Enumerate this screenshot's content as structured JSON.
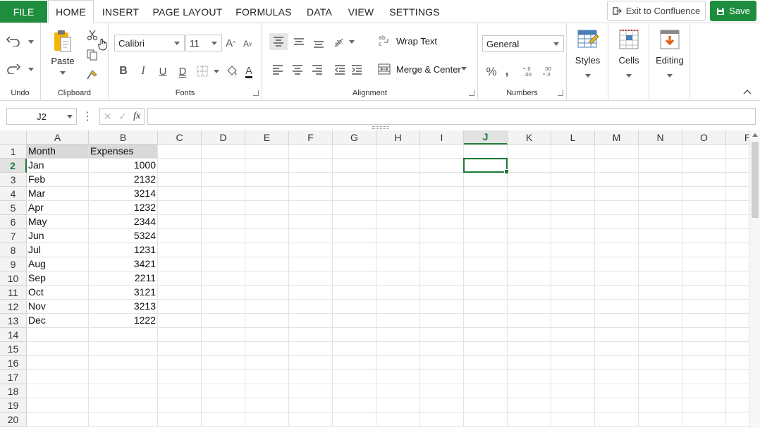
{
  "tabs": {
    "file": "FILE",
    "items": [
      "HOME",
      "INSERT",
      "PAGE LAYOUT",
      "FORMULAS",
      "DATA",
      "VIEW",
      "SETTINGS"
    ],
    "active": "HOME"
  },
  "actions": {
    "exit_label": "Exit to Confluence",
    "save_label": "Save"
  },
  "ribbon": {
    "undo_group": "Undo",
    "clipboard_group": "Clipboard",
    "paste_label": "Paste",
    "fonts_group": "Fonts",
    "font_name": "Calibri",
    "font_size": "11",
    "alignment_group": "Alignment",
    "wrap_text": "Wrap Text",
    "merge_center": "Merge & Center",
    "numbers_group": "Numbers",
    "number_format": "General",
    "styles_label": "Styles",
    "cells_label": "Cells",
    "editing_label": "Editing"
  },
  "formula_bar": {
    "name_box": "J2",
    "fx": "fx",
    "value": ""
  },
  "sheet": {
    "columns": [
      "A",
      "B",
      "C",
      "D",
      "E",
      "F",
      "G",
      "H",
      "I",
      "J",
      "K",
      "L",
      "M",
      "N",
      "O",
      "P"
    ],
    "row_count": 20,
    "selected_column": "J",
    "selected_row": 2,
    "header": [
      "Month",
      "Expenses"
    ],
    "rows": [
      [
        "Jan",
        1000
      ],
      [
        "Feb",
        2132
      ],
      [
        "Mar",
        3214
      ],
      [
        "Apr",
        1232
      ],
      [
        "May",
        2344
      ],
      [
        "Jun",
        5324
      ],
      [
        "Jul",
        1231
      ],
      [
        "Aug",
        3421
      ],
      [
        "Sep",
        2211
      ],
      [
        "Oct",
        3121
      ],
      [
        "Nov",
        3213
      ],
      [
        "Dec",
        1222
      ]
    ]
  },
  "colors": {
    "accent": "#1e8e3e",
    "selection": "#1e7a36"
  }
}
